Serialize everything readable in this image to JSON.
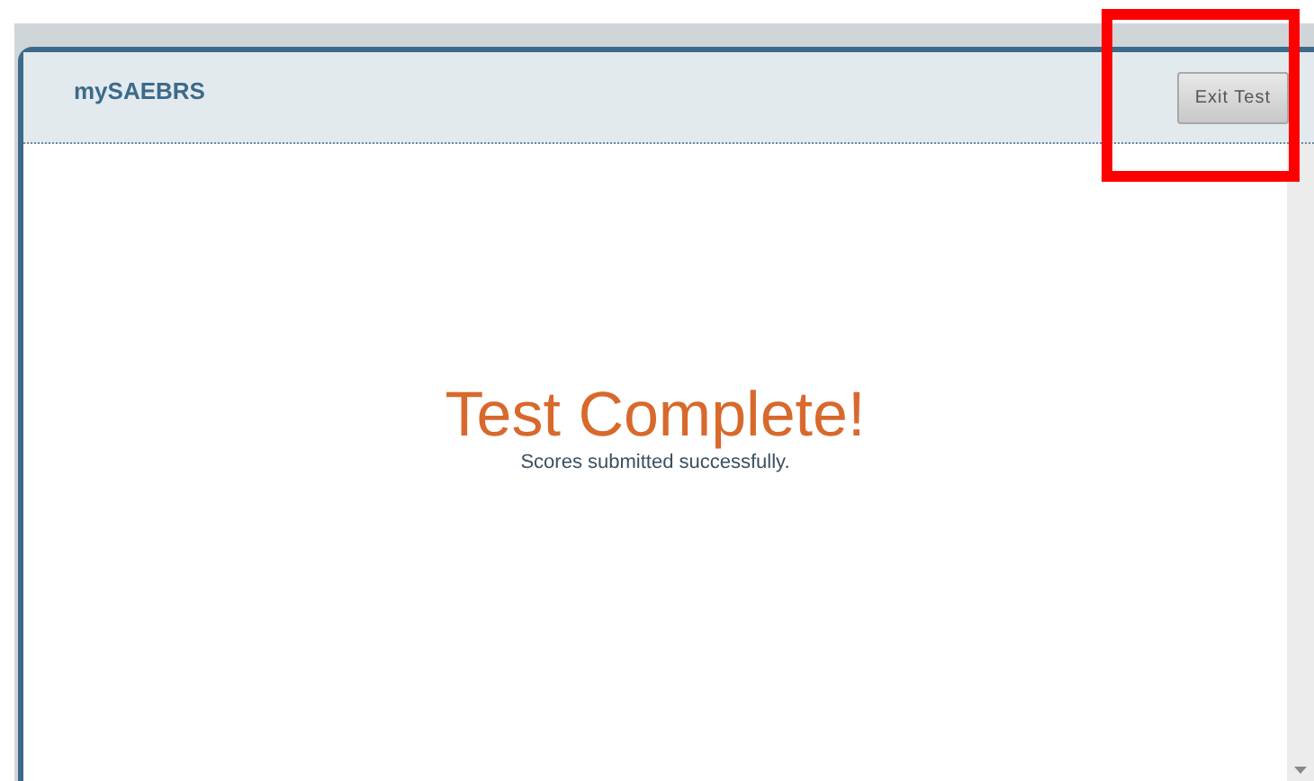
{
  "header": {
    "app_name": "mySAEBRS",
    "exit_button": "Exit Test"
  },
  "message": {
    "title": "Test Complete!",
    "subtitle": "Scores submitted successfully."
  }
}
